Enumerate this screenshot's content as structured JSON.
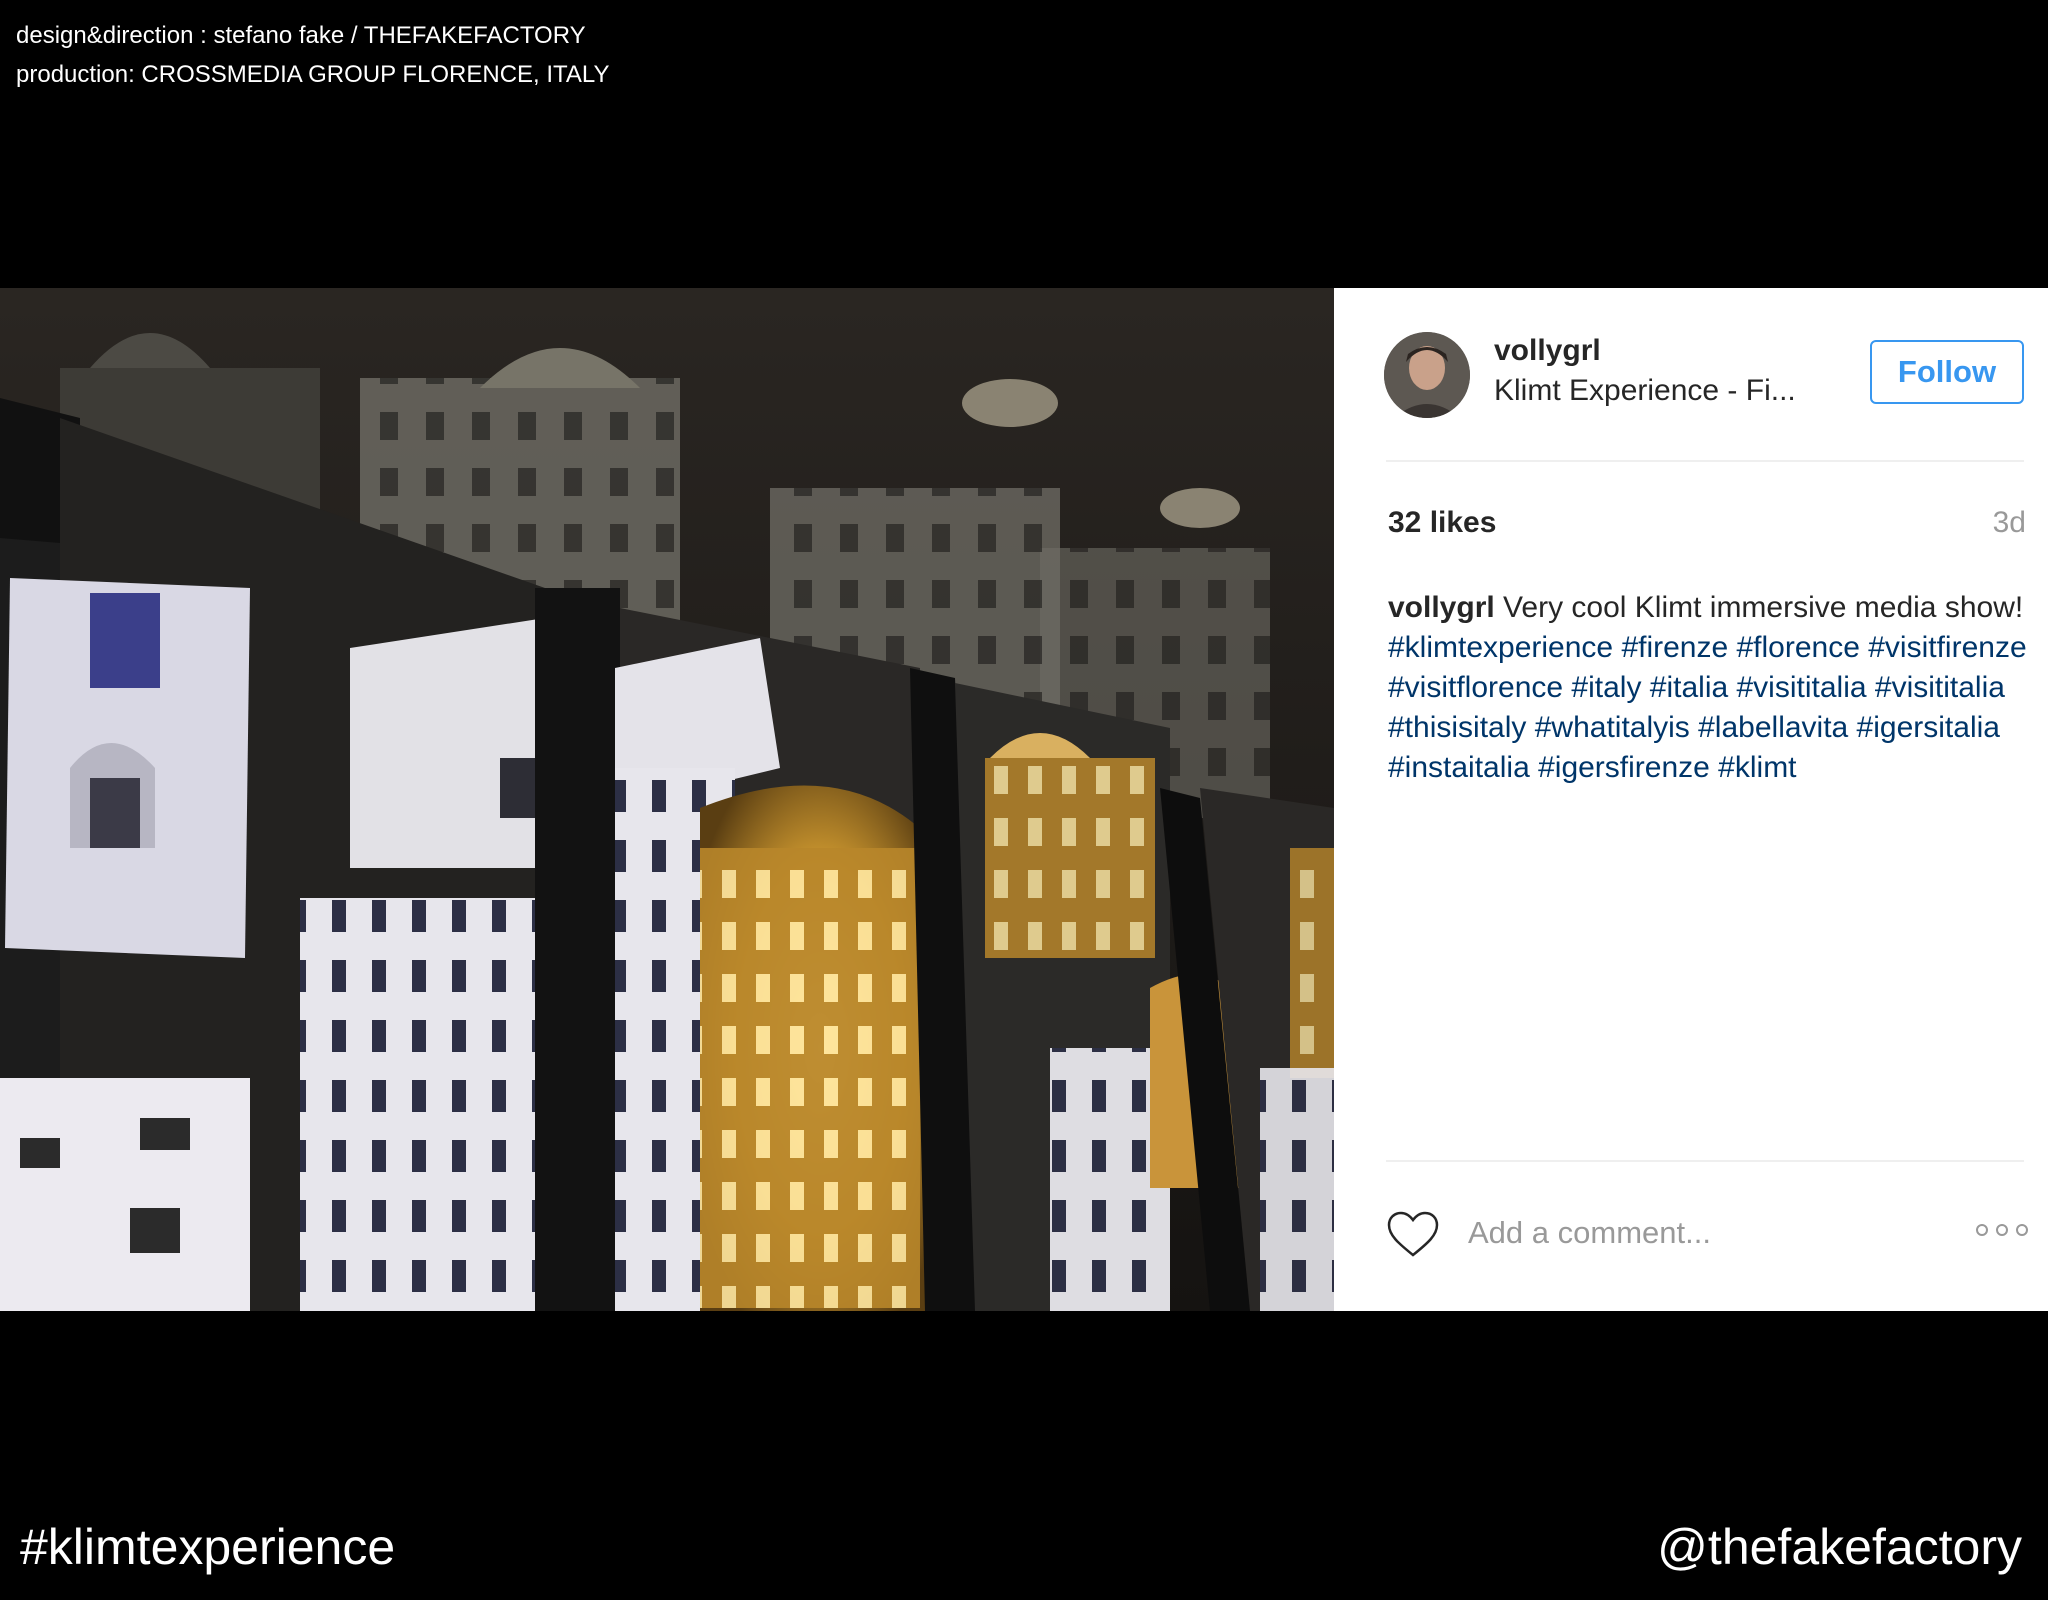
{
  "credits": {
    "line1": "design&direction : stefano fake / THEFAKEFACTORY",
    "line2": "production: CROSSMEDIA GROUP FLORENCE, ITALY"
  },
  "post": {
    "username": "vollygrl",
    "location": "Klimt Experience - Fi...",
    "follow_label": "Follow",
    "likes": "32 likes",
    "time": "3d",
    "caption_user": "vollygrl",
    "caption_text": "Very cool Klimt immersive media show!",
    "hashtags": "#klimtexperience #firenze #florence #visitfirenze #visitflorence #italy #italia #visititalia #visititalia #thisisitaly #whatitalyis #labellavita #igersitalia #instaitalia #igersfirenze #klimt",
    "comment_placeholder": "Add a comment..."
  },
  "footer": {
    "hashtag": "#klimtexperience",
    "handle": "@thefakefactory"
  },
  "colors": {
    "follow_blue": "#3897f0",
    "hashtag_blue": "#003569",
    "muted_gray": "#999999"
  },
  "icons": {
    "heart": "heart-outline-icon",
    "more": "more-options-icon"
  }
}
